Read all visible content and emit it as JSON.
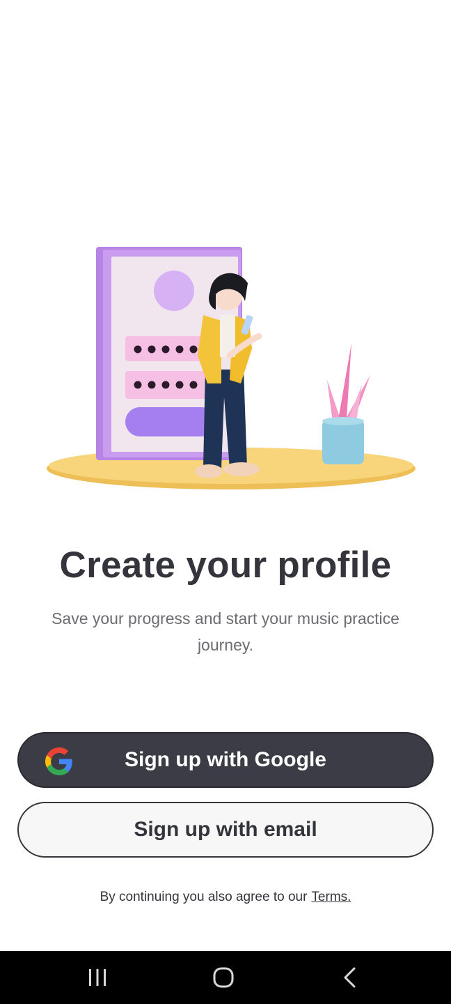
{
  "onboarding": {
    "title": "Create your profile",
    "subtitle": "Save your progress and start your music practice journey.",
    "google_button_label": "Sign up with Google",
    "email_button_label": "Sign up with email",
    "terms_text": "By continuing you also agree to our",
    "terms_link": "Terms."
  },
  "icons": {
    "google": "google-logo-icon",
    "illustration": "signup-illustration",
    "recents": "recents-icon",
    "home": "home-icon",
    "back": "back-icon"
  },
  "colors": {
    "primary_button": "#3b3c45",
    "text_dark": "#34353c",
    "text_muted": "#6b6c72",
    "nav_bar": "#000000"
  }
}
